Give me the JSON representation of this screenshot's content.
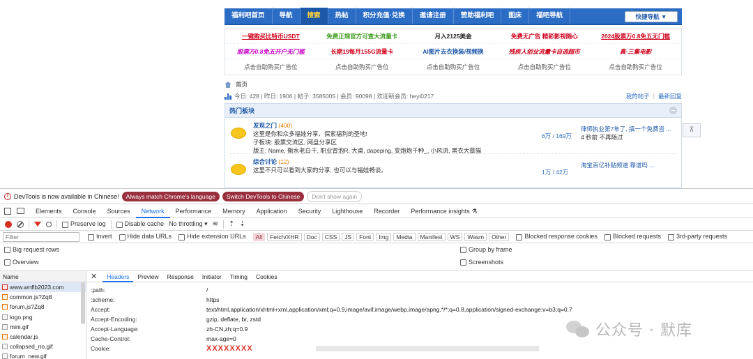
{
  "nav": {
    "items": [
      "福利吧首页",
      "导航",
      "搜索",
      "热帖",
      "积分充值·兑换",
      "邀请注册",
      "赞助福利吧",
      "图床",
      "福吧导航"
    ],
    "active_index": 2,
    "quick_nav": "快捷导航 ▼"
  },
  "ads": {
    "row1": [
      {
        "text": "一键购买比特币USDT",
        "color": "#d0021b",
        "style": "u"
      },
      {
        "text": "免费正规官方可查大流量卡",
        "color": "#3a9a1a",
        "style": "b"
      },
      {
        "text": "月入2125美金",
        "color": "#222222",
        "style": "b"
      },
      {
        "text": "免费无广告 精彩影视随心",
        "color": "#d0021b",
        "style": "b"
      },
      {
        "text": "2024股票万0.8免五无门槛",
        "color": "#d0021b",
        "style": "u"
      }
    ],
    "row2": [
      {
        "text": "股票万0.8免五开户无门槛",
        "color": "#c800c8",
        "style": "i"
      },
      {
        "text": "长期19每月155G流量卡",
        "color": "#d0021b",
        "style": "b"
      },
      {
        "text": "AI图片去衣换装/视频换",
        "color": "#1d58a8",
        "style": "b"
      },
      {
        "text": "残疾人创业流量卡自选超市",
        "color": "#d0021b",
        "style": "i"
      },
      {
        "text": "真·三集电影",
        "color": "#d0021b",
        "style": "i"
      }
    ],
    "row3": [
      "点击自助购买广告位",
      "点击自助购买广告位",
      "点击自助购买广告位",
      "点击自助购买广告位",
      "点击自助购买广告位"
    ]
  },
  "breadcrumb": {
    "home": "首页"
  },
  "stats": {
    "text": "今日: 428 | 昨日: 1906 | 帖子: 3585005 | 会员: 90098 | 欢迎新会员: heyi0217",
    "my_posts": "我的帖子",
    "latest": "最新回复"
  },
  "hot": {
    "title": "热门板块",
    "forums": [
      {
        "name": "发现之门",
        "count": "(400)",
        "desc": "这里是你和众多福娃分享、探索福利的圣地!",
        "sub": "子板块: 股票交流区, 网盘分享区",
        "mods": "版主: Name, 衡水老白干, 职业冒泡R, 大桌, dapeping, 变炮炮千种_, 小风流, 黑衣大墓猫",
        "stat": "6万 / 169万",
        "last_title": "律师执业第7年了, 搞一个免费咨 ...",
        "last_time": "4 秒前 不再随过"
      },
      {
        "name": "综合讨论",
        "count": "(12)",
        "desc": "这里不只可以看到大家的分享, 也可以与福娃畅谈。",
        "sub": "",
        "mods": "",
        "stat": "1万 / 42万",
        "last_title": "淘宝百亿补贴频道 靠谱吗 ...",
        "last_time": ""
      }
    ],
    "side_button": "⊼"
  },
  "devtools": {
    "infobar": {
      "message": "DevTools is now available in Chinese!",
      "btn_match": "Always match Chrome's language",
      "btn_switch": "Switch DevTools to Chinese",
      "btn_dismiss": "Don't show again"
    },
    "tabs": [
      "Elements",
      "Console",
      "Sources",
      "Network",
      "Performance",
      "Memory",
      "Application",
      "Security",
      "Lighthouse",
      "Recorder",
      "Performance insights ⚗"
    ],
    "active_tab": 3,
    "toolbar": {
      "preserve_log": "Preserve log",
      "disable_cache": "Disable cache",
      "throttling": "No throttling ▾"
    },
    "filterbar": {
      "placeholder": "Filter",
      "invert": "Invert",
      "hide_data": "Hide data URLs",
      "hide_ext": "Hide extension URLs",
      "types": [
        "All",
        "Fetch/XHR",
        "Doc",
        "CSS",
        "JS",
        "Font",
        "Img",
        "Media",
        "Manifest",
        "WS",
        "Wasm",
        "Other"
      ],
      "blocked_cookies": "Blocked response cookies",
      "blocked_requests": "Blocked requests",
      "third_party": "3rd-party requests"
    },
    "options": {
      "big_rows": "Big request rows",
      "group_frame": "Group by frame",
      "overview": "Overview",
      "screenshots": "Screenshots"
    },
    "name_header": "Name",
    "requests": [
      {
        "name": "www.wnflb2023.com",
        "type": "doc"
      },
      {
        "name": "common.js?Zq8",
        "type": "js"
      },
      {
        "name": "forum.js?Zq8",
        "type": "js"
      },
      {
        "name": "logo.png",
        "type": "img"
      },
      {
        "name": "mini.gif",
        "type": "img"
      },
      {
        "name": "calendar.js",
        "type": "js"
      },
      {
        "name": "collapsed_no.gif",
        "type": "img"
      },
      {
        "name": "forum_new.gif",
        "type": "img"
      }
    ],
    "detail_tabs": [
      "Headers",
      "Preview",
      "Response",
      "Initiator",
      "Timing",
      "Cookies"
    ],
    "headers": [
      {
        "k": ":path:",
        "v": "/"
      },
      {
        "k": ":scheme:",
        "v": "https"
      },
      {
        "k": "Accept:",
        "v": "text/html,application/xhtml+xml,application/xml;q=0.9,image/avif,image/webp,image/apng,*/*;q=0.8,application/signed-exchange;v=b3;q=0.7"
      },
      {
        "k": "Accept-Encoding:",
        "v": "gzip, deflate, br, zstd"
      },
      {
        "k": "Accept-Language:",
        "v": "zh-CN,zh;q=0.9"
      },
      {
        "k": "Cache-Control:",
        "v": "max-age=0"
      },
      {
        "k": "Cookie:",
        "v": "XXXXXXXX"
      }
    ]
  },
  "watermark": {
    "text": "公众号 · 默库"
  }
}
